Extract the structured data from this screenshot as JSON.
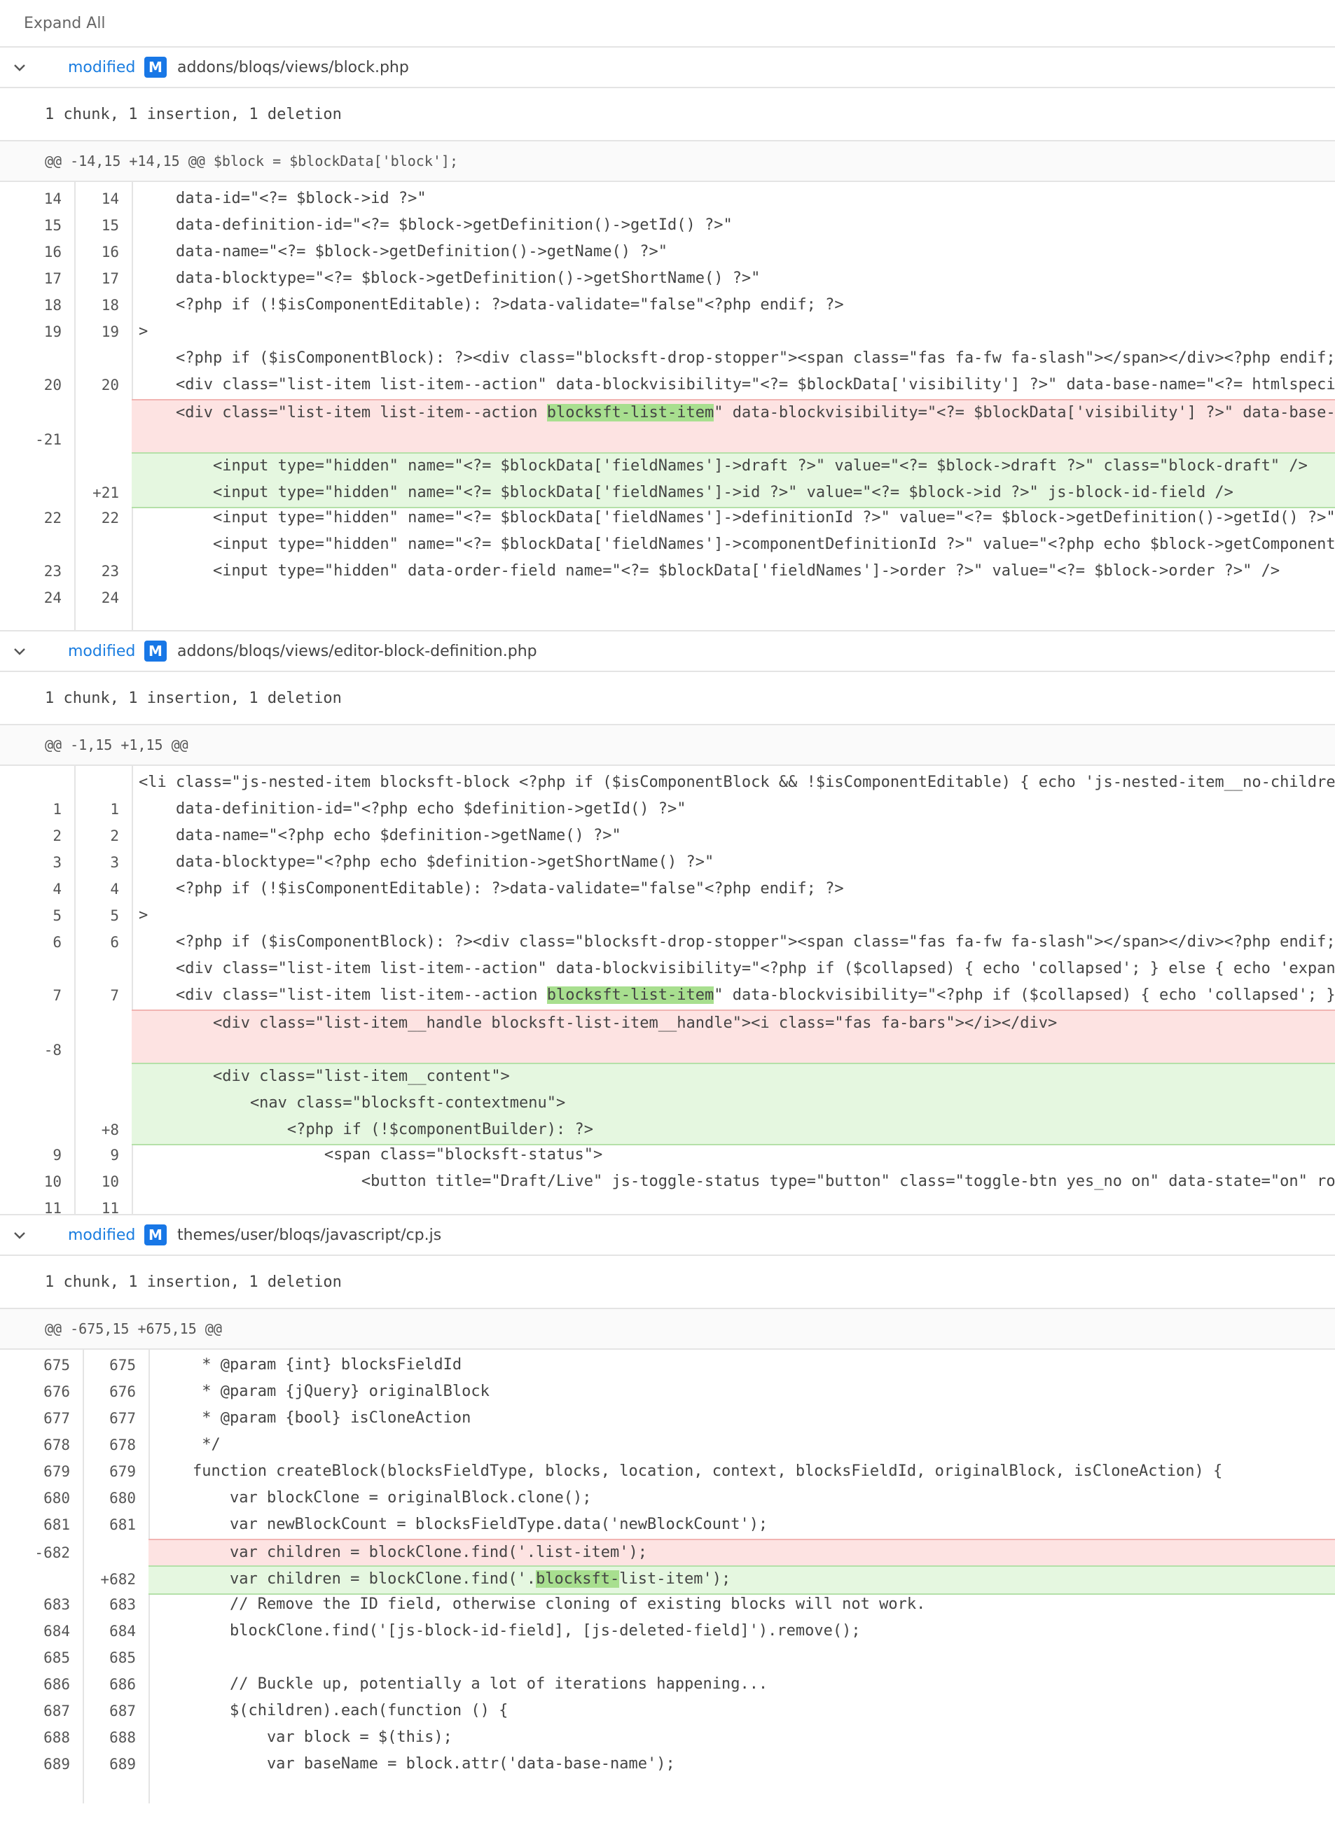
{
  "toolbar": {
    "expand_all": "Expand All"
  },
  "files": [
    {
      "status": "modified",
      "badge": "M",
      "path": "addons/bloqs/views/block.php",
      "summary": "1 chunk, 1 insertion, 1 deletion",
      "hunk": "@@ -14,15 +14,15 @@ $block = $blockData['block'];"
    },
    {
      "status": "modified",
      "badge": "M",
      "path": "addons/bloqs/views/editor-block-definition.php",
      "summary": "1 chunk, 1 insertion, 1 deletion",
      "hunk": "@@ -1,15 +1,15 @@"
    },
    {
      "status": "modified",
      "badge": "M",
      "path": "themes/user/bloqs/javascript/cp.js",
      "summary": "1 chunk, 1 insertion, 1 deletion",
      "hunk": "@@ -675,15 +675,15 @@"
    }
  ],
  "code1": [
    {
      "old": "14",
      "new": "14",
      "text": "    data-id=\"<?= $block->id ?>\""
    },
    {
      "old": "15",
      "new": "15",
      "text": "    data-definition-id=\"<?= $block->getDefinition()->getId() ?>\""
    },
    {
      "old": "16",
      "new": "16",
      "text": "    data-name=\"<?= $block->getDefinition()->getName() ?>\""
    },
    {
      "old": "17",
      "new": "17",
      "text": "    data-blocktype=\"<?= $block->getDefinition()->getShortName() ?>\""
    },
    {
      "old": "18",
      "new": "18",
      "text": "    <?php if (!$isComponentEditable): ?>data-validate=\"false\"<?php endif; ?>"
    },
    {
      "old": "19",
      "new": "19",
      "text": ">"
    },
    {
      "old": "",
      "new": "",
      "text": "    <?php if ($isComponentBlock): ?><div class=\"blocksft-drop-stopper\"><span class=\"fas fa-fw fa-slash\"></span></div><?php endif;"
    },
    {
      "old": "20",
      "new": "20",
      "text": "    <div class=\"list-item list-item--action\" data-blockvisibility=\"<?= $blockData['visibility'] ?>\" data-base-name=\"<?= htmlspeci"
    },
    {
      "old": "-21",
      "new": "",
      "kind": "del",
      "pre": "    <div class=\"list-item list-item--action ",
      "hl": "blocksft-list-item",
      "post": "\" data-blockvisibility=\"<?= $blockData['visibility'] ?>\" data-base-"
    },
    {
      "old": "",
      "new": "+21",
      "kind": "add",
      "lines": [
        "        <input type=\"hidden\" name=\"<?= $blockData['fieldNames']->draft ?>\" value=\"<?= $block->draft ?>\" class=\"block-draft\" />",
        "        <input type=\"hidden\" name=\"<?= $blockData['fieldNames']->id ?>\" value=\"<?= $block->id ?>\" js-block-id-field />"
      ]
    },
    {
      "old": "22",
      "new": "22",
      "text": "        <input type=\"hidden\" name=\"<?= $blockData['fieldNames']->definitionId ?>\" value=\"<?= $block->getDefinition()->getId() ?>\""
    },
    {
      "old": "",
      "new": "",
      "text": "        <input type=\"hidden\" name=\"<?= $blockData['fieldNames']->componentDefinitionId ?>\" value=\"<?php echo $block->getComponent"
    },
    {
      "old": "23",
      "new": "23",
      "text": "        <input type=\"hidden\" data-order-field name=\"<?= $blockData['fieldNames']->order ?>\" value=\"<?= $block->order ?>\" />"
    },
    {
      "old": "24",
      "new": "24",
      "text": ""
    }
  ],
  "code2": [
    {
      "old": "",
      "new": "",
      "text": "<li class=\"js-nested-item blocksft-block <?php if ($isComponentBlock && !$isComponentEditable) { echo 'js-nested-item__no-childre"
    },
    {
      "old": "1",
      "new": "1",
      "text": "    data-definition-id=\"<?php echo $definition->getId() ?>\""
    },
    {
      "old": "2",
      "new": "2",
      "text": "    data-name=\"<?php echo $definition->getName() ?>\""
    },
    {
      "old": "3",
      "new": "3",
      "text": "    data-blocktype=\"<?php echo $definition->getShortName() ?>\""
    },
    {
      "old": "4",
      "new": "4",
      "text": "    <?php if (!$isComponentEditable): ?>data-validate=\"false\"<?php endif; ?>"
    },
    {
      "old": "5",
      "new": "5",
      "text": ">"
    },
    {
      "old": "6",
      "new": "6",
      "text": "    <?php if ($isComponentBlock): ?><div class=\"blocksft-drop-stopper\"><span class=\"fas fa-fw fa-slash\"></span></div><?php endif;"
    },
    {
      "old": "",
      "new": "",
      "text": "    <div class=\"list-item list-item--action\" data-blockvisibility=\"<?php if ($collapsed) { echo 'collapsed'; } else { echo 'expan"
    },
    {
      "old": "7",
      "new": "7",
      "pre": "    <div class=\"list-item list-item--action ",
      "hl": "blocksft-list-item",
      "post": "\" data-blockvisibility=\"<?php if ($collapsed) { echo 'collapsed'; }"
    },
    {
      "old": "-8",
      "new": "",
      "kind": "del",
      "text": "        <div class=\"list-item__handle blocksft-list-item__handle\"><i class=\"fas fa-bars\"></i></div>"
    },
    {
      "old": "",
      "new": "+8",
      "kind": "add",
      "lines": [
        "        <div class=\"list-item__content\">",
        "            <nav class=\"blocksft-contextmenu\">",
        "                <?php if (!$componentBuilder): ?>"
      ]
    },
    {
      "old": "9",
      "new": "9",
      "text": "                    <span class=\"blocksft-status\">"
    },
    {
      "old": "10",
      "new": "10",
      "text": "                        <button title=\"Draft/Live\" js-toggle-status type=\"button\" class=\"toggle-btn yes_no on\" data-state=\"on\" ro"
    },
    {
      "old": "11",
      "new": "11",
      "text": ""
    }
  ],
  "code3": [
    {
      "old": "675",
      "new": "675",
      "text": "     * @param {int} blocksFieldId"
    },
    {
      "old": "676",
      "new": "676",
      "text": "     * @param {jQuery} originalBlock"
    },
    {
      "old": "677",
      "new": "677",
      "text": "     * @param {bool} isCloneAction"
    },
    {
      "old": "678",
      "new": "678",
      "text": "     */"
    },
    {
      "old": "679",
      "new": "679",
      "text": "    function createBlock(blocksFieldType, blocks, location, context, blocksFieldId, originalBlock, isCloneAction) {"
    },
    {
      "old": "680",
      "new": "680",
      "text": "        var blockClone = originalBlock.clone();"
    },
    {
      "old": "681",
      "new": "681",
      "text": "        var newBlockCount = blocksFieldType.data('newBlockCount');"
    },
    {
      "old": "-682",
      "new": "",
      "kind": "del",
      "text": "        var children = blockClone.find('.list-item');"
    },
    {
      "old": "",
      "new": "+682",
      "kind": "add",
      "pre": "        var children = blockClone.find('.",
      "hl": "blocksft-",
      "post": "list-item');"
    },
    {
      "old": "683",
      "new": "683",
      "text": "        // Remove the ID field, otherwise cloning of existing blocks will not work."
    },
    {
      "old": "684",
      "new": "684",
      "text": "        blockClone.find('[js-block-id-field], [js-deleted-field]').remove();"
    },
    {
      "old": "685",
      "new": "685",
      "text": ""
    },
    {
      "old": "686",
      "new": "686",
      "text": "        // Buckle up, potentially a lot of iterations happening..."
    },
    {
      "old": "687",
      "new": "687",
      "text": "        $(children).each(function () {"
    },
    {
      "old": "688",
      "new": "688",
      "text": "            var block = $(this);"
    },
    {
      "old": "689",
      "new": "689",
      "text": "            var baseName = block.attr('data-base-name');"
    }
  ]
}
